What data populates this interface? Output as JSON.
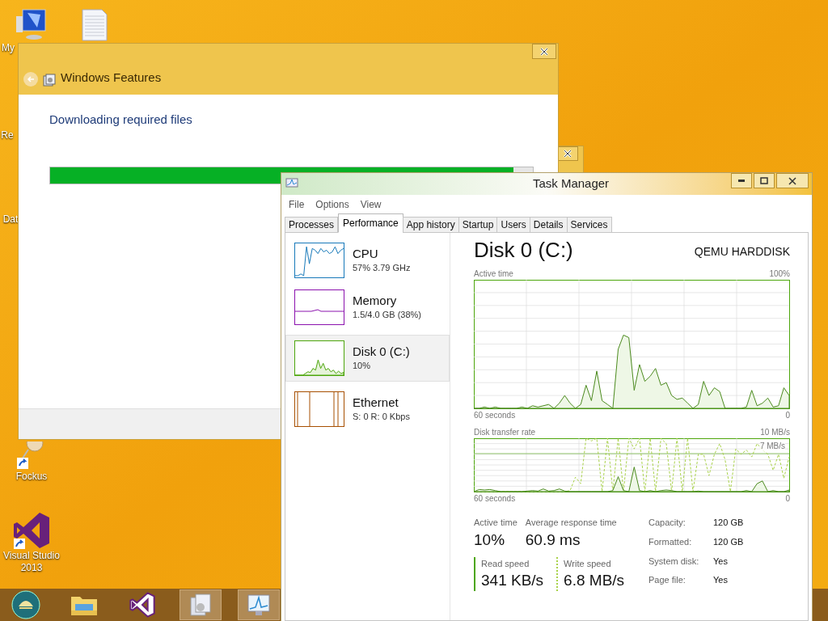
{
  "desktop_icons": [
    {
      "kind": "computer",
      "label": "My"
    },
    {
      "kind": "document"
    },
    {
      "kind": "plain",
      "label": "Re"
    },
    {
      "kind": "plain",
      "label": "Dat"
    },
    {
      "kind": "magnifier",
      "label": "Fockus"
    },
    {
      "kind": "studio",
      "label": "Visual Studio 2013"
    }
  ],
  "features_window": {
    "title": "Windows Features",
    "message": "Downloading required files",
    "progress": {
      "level": 0.96
    }
  },
  "task_manager": {
    "title": "Task Manager",
    "menu": [
      "File",
      "Options",
      "View"
    ],
    "tabs": [
      {
        "label": "Processes",
        "selected": false
      },
      {
        "label": "Performance",
        "selected": true
      },
      {
        "label": "App history",
        "selected": false
      },
      {
        "label": "Startup",
        "selected": false
      },
      {
        "label": "Users",
        "selected": false
      },
      {
        "label": "Details",
        "selected": false
      },
      {
        "label": "Services",
        "selected": false
      }
    ],
    "resources": [
      {
        "kind": "cpu",
        "name": "CPU",
        "detail": "57% 3.79 GHz",
        "selected": false,
        "color": "#1779ba"
      },
      {
        "kind": "memory",
        "name": "Memory",
        "detail": "1.5/4.0 GB (38%)",
        "selected": false,
        "color": "#8b12ae"
      },
      {
        "kind": "disk",
        "name": "Disk 0 (C:)",
        "detail": "10%",
        "selected": true,
        "color": "#4da60c"
      },
      {
        "kind": "ethernet",
        "name": "Ethernet",
        "detail": "S: 0 R: 0 Kbps",
        "selected": false,
        "color": "#a74f01"
      }
    ],
    "detail": {
      "title": "Disk 0 (C:)",
      "model": "QEMU HARDDISK",
      "active_chart": {
        "label": "Active time",
        "max": "100%",
        "span": "60 seconds",
        "min": "0"
      },
      "transfer_chart": {
        "label": "Disk transfer rate",
        "max": "10 MB/s",
        "line_label": "7 MB/s",
        "span": "60 seconds",
        "min": "0"
      },
      "stats": [
        {
          "label": "Active time",
          "value": "10%"
        },
        {
          "label": "Average response time",
          "value": "60.9 ms"
        }
      ],
      "speeds": [
        {
          "kind": "solid",
          "label": "Read speed",
          "value": "341 KB/s"
        },
        {
          "kind": "dashed",
          "label": "Write speed",
          "value": "6.8 MB/s"
        }
      ],
      "properties": [
        {
          "label": "Capacity:",
          "value": "120 GB"
        },
        {
          "label": "Formatted:",
          "value": "120 GB"
        },
        {
          "label": "System disk:",
          "value": "Yes"
        },
        {
          "label": "Page file:",
          "value": "Yes"
        }
      ]
    }
  },
  "taskbar": {
    "items": [
      {
        "kind": "start",
        "open": false
      },
      {
        "kind": "explorer",
        "open": false
      },
      {
        "kind": "studio",
        "open": false
      },
      {
        "kind": "features",
        "open": true
      },
      {
        "kind": "monitor",
        "open": true
      }
    ]
  }
}
